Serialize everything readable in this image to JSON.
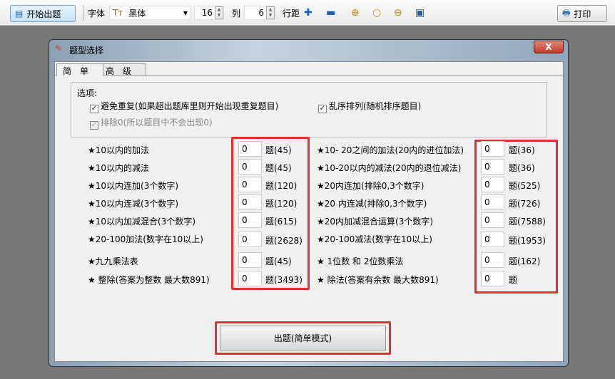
{
  "toolbar": {
    "start": "开始出题",
    "font_label": "字体",
    "font_value": "黑体",
    "size": "16",
    "cols_label": "列",
    "cols": "6",
    "line_label": "行距",
    "print": "打印"
  },
  "dialog": {
    "title": "题型选择",
    "close": "X",
    "tabs": [
      "简单",
      "高级"
    ],
    "options_label": "选项:",
    "opt_no_repeat": "避免重复(如果超出题库里则开始出现重复题目)",
    "opt_shuffle": "乱序排列(随机排序题目)",
    "opt_exclude0": "排除0(所以题目中不会出现0)",
    "left": [
      {
        "label": "★10以内的加法",
        "value": "0",
        "count": "题(45)"
      },
      {
        "label": "★10以内的减法",
        "value": "0",
        "count": "题(45)"
      },
      {
        "label": "★10以内连加(3个数字)",
        "value": "0",
        "count": "题(120)"
      },
      {
        "label": "★10以内连减(3个数字)",
        "value": "0",
        "count": "题(120)"
      },
      {
        "label": "★10以内加减混合(3个数字)",
        "value": "0",
        "count": "题(615)"
      },
      {
        "label": "★20-100加法(数字在10以上)",
        "value": "0",
        "count": "题(2628)"
      },
      {
        "label": "★九九乘法表",
        "value": "0",
        "count": "题(45)"
      },
      {
        "label": "★ 整除(答案为整数 最大数891)",
        "value": "0",
        "count": "题(3493)"
      }
    ],
    "right": [
      {
        "label": "★10- 20之间的加法(20内的进位加法)",
        "value": "0",
        "count": "题(36)"
      },
      {
        "label": "★10-20以内的减法(20内的退位减法)",
        "value": "0",
        "count": "题(36)"
      },
      {
        "label": "★20内连加(排除0,3个数字)",
        "value": "0",
        "count": "题(525)"
      },
      {
        "label": "★20 内连减(排除0,3个数字)",
        "value": "0",
        "count": "题(726)"
      },
      {
        "label": "★20内加减混合运算(3个数字)",
        "value": "0",
        "count": "题(7588)"
      },
      {
        "label": "★20-100减法(数字在10以上)",
        "value": "0",
        "count": "题(1953)"
      },
      {
        "label": "★ 1位数 和 2位数乘法",
        "value": "0",
        "count": "题(162)"
      },
      {
        "label": "★ 除法(答案有余数 最大数891)",
        "value": "0",
        "count": "题"
      }
    ],
    "generate": "出题(简单模式)"
  }
}
